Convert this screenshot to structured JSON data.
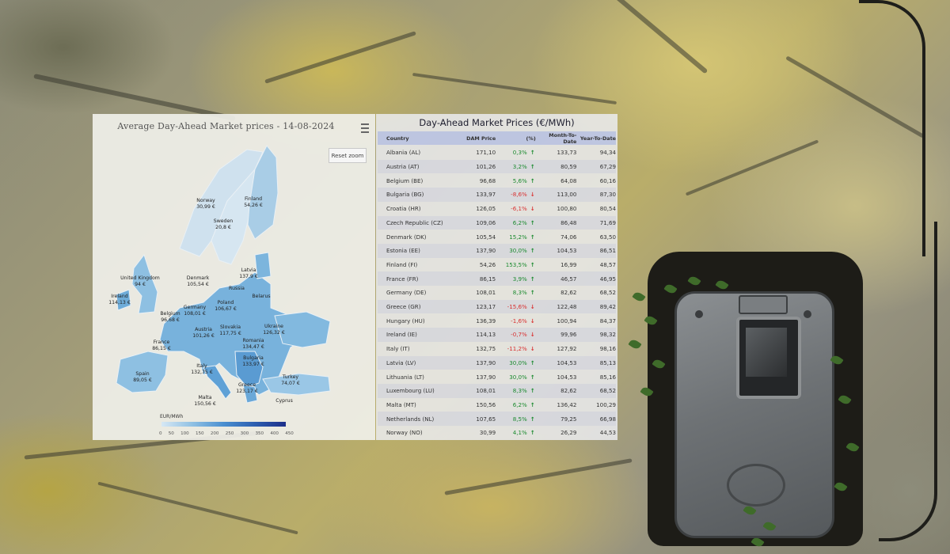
{
  "map": {
    "title": "Average Day-Ahead Market prices - 14-08-2024",
    "reset_zoom": "Reset zoom",
    "legend_title": "EUR/MWh",
    "legend_ticks": [
      "0",
      "50",
      "100",
      "150",
      "200",
      "250",
      "300",
      "350",
      "400",
      "450"
    ],
    "labels": [
      {
        "name": "Norway",
        "value": "30,99 €"
      },
      {
        "name": "Finland",
        "value": "54,26 €"
      },
      {
        "name": "Sweden",
        "value": "20,8 €"
      },
      {
        "name": "Latvia",
        "value": "137,9 €"
      },
      {
        "name": "Denmark",
        "value": "105,54 €"
      },
      {
        "name": "United Kingdom",
        "value": "94 €"
      },
      {
        "name": "Ireland",
        "value": "114,13 €"
      },
      {
        "name": "Russia",
        "value": ""
      },
      {
        "name": "Belarus",
        "value": ""
      },
      {
        "name": "Germany",
        "value": "108,01 €"
      },
      {
        "name": "Poland",
        "value": "106,67 €"
      },
      {
        "name": "Belgium",
        "value": "96,68 €"
      },
      {
        "name": "Austria",
        "value": "101,26 €"
      },
      {
        "name": "Slovakia",
        "value": "117,75 €"
      },
      {
        "name": "Ukraine",
        "value": "126,32 €"
      },
      {
        "name": "France",
        "value": "86,15 €"
      },
      {
        "name": "Romania",
        "value": "134,47 €"
      },
      {
        "name": "Bulgaria",
        "value": "133,97 €"
      },
      {
        "name": "Italy",
        "value": "132,75 €"
      },
      {
        "name": "Spain",
        "value": "89,05 €"
      },
      {
        "name": "Greece",
        "value": "123,17 €"
      },
      {
        "name": "Turkey",
        "value": "74,07 €"
      },
      {
        "name": "Malta",
        "value": "150,56 €"
      },
      {
        "name": "Cyprus",
        "value": ""
      }
    ]
  },
  "table": {
    "title": "Day-Ahead Market Prices (€/MWh)",
    "headers": {
      "country": "Country",
      "dam": "DAM Price",
      "pct": "(%)",
      "mtd": "Month-To-Date",
      "ytd": "Year-To-Date"
    },
    "rows": [
      {
        "country": "Albania (AL)",
        "dam": "171,10",
        "pct": "0,3%",
        "dir": "up",
        "mtd": "133,73",
        "ytd": "94,34"
      },
      {
        "country": "Austria (AT)",
        "dam": "101,26",
        "pct": "3,2%",
        "dir": "up",
        "mtd": "80,59",
        "ytd": "67,29"
      },
      {
        "country": "Belgium (BE)",
        "dam": "96,68",
        "pct": "5,6%",
        "dir": "up",
        "mtd": "64,08",
        "ytd": "60,16"
      },
      {
        "country": "Bulgaria (BG)",
        "dam": "133,97",
        "pct": "-8,6%",
        "dir": "down",
        "mtd": "113,00",
        "ytd": "87,30"
      },
      {
        "country": "Croatia (HR)",
        "dam": "126,05",
        "pct": "-6,1%",
        "dir": "down",
        "mtd": "100,80",
        "ytd": "80,54"
      },
      {
        "country": "Czech Republic (CZ)",
        "dam": "109,06",
        "pct": "6,2%",
        "dir": "up",
        "mtd": "86,48",
        "ytd": "71,69"
      },
      {
        "country": "Denmark (DK)",
        "dam": "105,54",
        "pct": "15,2%",
        "dir": "up",
        "mtd": "74,06",
        "ytd": "63,50"
      },
      {
        "country": "Estonia (EE)",
        "dam": "137,90",
        "pct": "30,0%",
        "dir": "up",
        "mtd": "104,53",
        "ytd": "86,51"
      },
      {
        "country": "Finland (FI)",
        "dam": "54,26",
        "pct": "153,5%",
        "dir": "up",
        "mtd": "16,99",
        "ytd": "48,57"
      },
      {
        "country": "France (FR)",
        "dam": "86,15",
        "pct": "3,9%",
        "dir": "up",
        "mtd": "46,57",
        "ytd": "46,95"
      },
      {
        "country": "Germany (DE)",
        "dam": "108,01",
        "pct": "8,3%",
        "dir": "up",
        "mtd": "82,62",
        "ytd": "68,52"
      },
      {
        "country": "Greece (GR)",
        "dam": "123,17",
        "pct": "-15,6%",
        "dir": "down",
        "mtd": "122,48",
        "ytd": "89,42"
      },
      {
        "country": "Hungary (HU)",
        "dam": "136,39",
        "pct": "-1,6%",
        "dir": "down",
        "mtd": "100,94",
        "ytd": "84,37"
      },
      {
        "country": "Ireland (IE)",
        "dam": "114,13",
        "pct": "-0,7%",
        "dir": "down",
        "mtd": "99,96",
        "ytd": "98,32"
      },
      {
        "country": "Italy (IT)",
        "dam": "132,75",
        "pct": "-11,2%",
        "dir": "down",
        "mtd": "127,92",
        "ytd": "98,16"
      },
      {
        "country": "Latvia (LV)",
        "dam": "137,90",
        "pct": "30,0%",
        "dir": "up",
        "mtd": "104,53",
        "ytd": "85,13"
      },
      {
        "country": "Lithuania (LT)",
        "dam": "137,90",
        "pct": "30,0%",
        "dir": "up",
        "mtd": "104,53",
        "ytd": "85,16"
      },
      {
        "country": "Luxembourg (LU)",
        "dam": "108,01",
        "pct": "8,3%",
        "dir": "up",
        "mtd": "82,62",
        "ytd": "68,52"
      },
      {
        "country": "Malta (MT)",
        "dam": "150,56",
        "pct": "6,2%",
        "dir": "up",
        "mtd": "136,42",
        "ytd": "100,29"
      },
      {
        "country": "Netherlands (NL)",
        "dam": "107,65",
        "pct": "8,5%",
        "dir": "up",
        "mtd": "79,25",
        "ytd": "66,98"
      },
      {
        "country": "Norway (NO)",
        "dam": "30,99",
        "pct": "4,1%",
        "dir": "up",
        "mtd": "26,29",
        "ytd": "44,53"
      }
    ]
  },
  "icons": {
    "menu": "hamburger-menu-icon",
    "up": "arrow-up-icon",
    "down": "arrow-down-icon"
  },
  "colors": {
    "up": "#1a8a2e",
    "down": "#d93030",
    "header_bg": "#b4bee1"
  }
}
